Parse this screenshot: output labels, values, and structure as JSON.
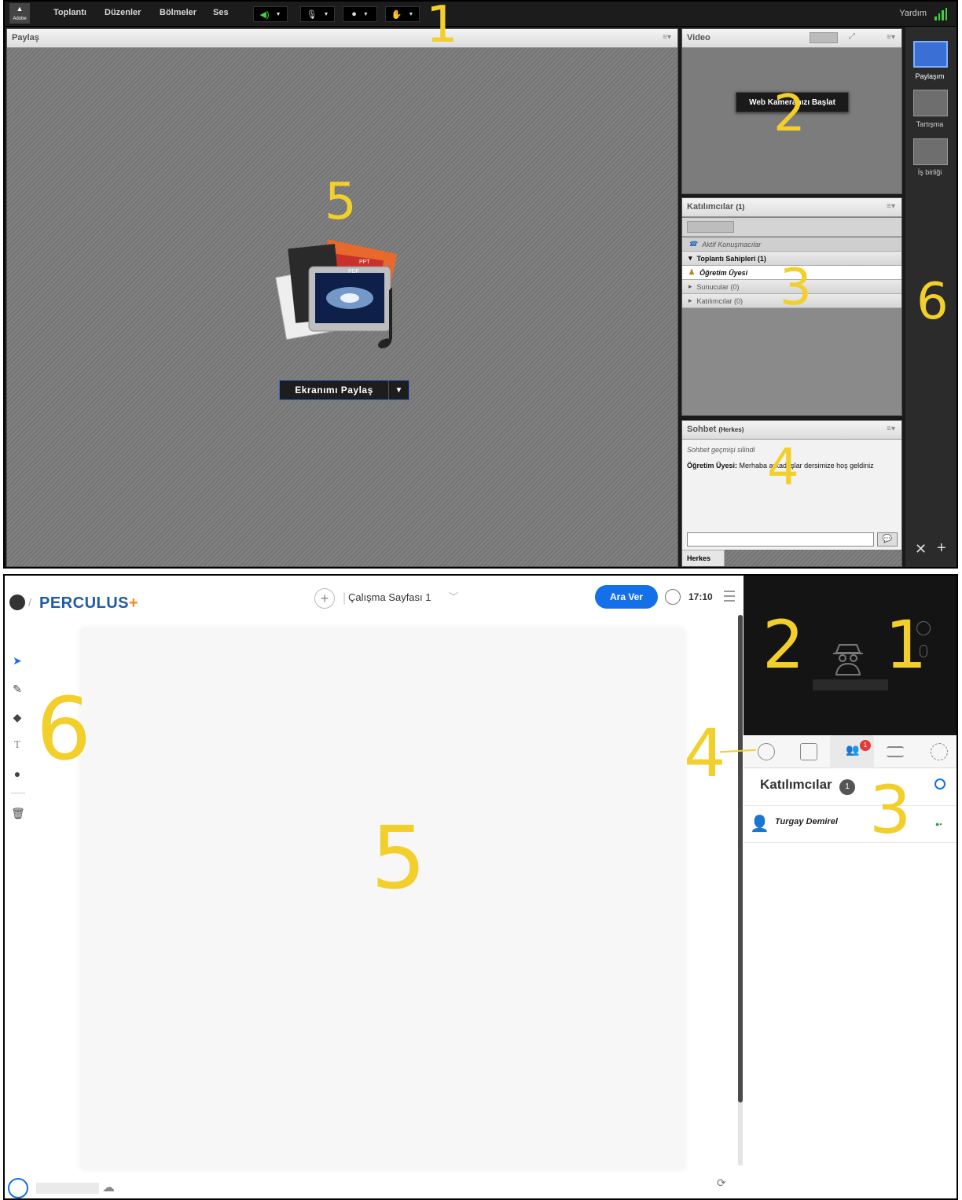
{
  "adobe": {
    "menu": [
      "Toplantı",
      "Düzenler",
      "Bölmeler",
      "Ses"
    ],
    "help": "Yardım",
    "share_pod": {
      "title": "Paylaş",
      "button": "Ekranımı Paylaş",
      "doc_labels": [
        "PPT",
        "PDF"
      ]
    },
    "video_pod": {
      "title": "Video",
      "button": "Web Kameranızı Başlat"
    },
    "attendees_pod": {
      "title": "Katılımcılar",
      "count": "(1)",
      "active_speakers": "Aktif Konuşmacılar",
      "groups": [
        "Toplantı Sahipleri (1)",
        "Sunucular (0)",
        "Katılımcılar (0)"
      ],
      "host": "Öğretim Üyesi"
    },
    "chat_pod": {
      "title": "Sohbet",
      "scope": "(Herkes)",
      "history_cleared": "Sohbet geçmişi silindi",
      "sender": "Öğretim Üyesi:",
      "message": " Merhaba arkadaşlar dersimize hoş geldiniz",
      "recipient_tab": "Herkes"
    },
    "layouts": [
      "Paylaşım",
      "Tartışma",
      "İş birliği"
    ]
  },
  "perculus": {
    "brand": "PERCULUS",
    "brand_plus": "+",
    "page_name": "Çalışma Sayfası 1",
    "break_button": "Ara Ver",
    "time": "17:10",
    "participants_title": "Katılımcılar",
    "participants_count": "1",
    "participant_name": "Turgay Demirel",
    "tab_badge": "1"
  },
  "callouts": {
    "adobe": [
      "1",
      "2",
      "3",
      "4",
      "5",
      "6"
    ],
    "perculus": [
      "1",
      "2",
      "3",
      "4",
      "5",
      "6"
    ]
  },
  "colors": {
    "accent_blue": "#1370e8",
    "brand_orange": "#f58a1f",
    "callout_yellow": "#f2cf2b",
    "ac_select": "#3a6fd6"
  },
  "icons": [
    "speaker-icon",
    "microphone-icon",
    "webcam-icon",
    "raise-hand-icon",
    "signal-icon",
    "menu-icon",
    "search-icon",
    "clock-icon",
    "chat-icon",
    "folder-icon",
    "participants-icon",
    "list-icon",
    "gear-icon",
    "pointer-icon",
    "pencil-icon",
    "eraser-icon",
    "text-icon",
    "color-icon",
    "delete-icon",
    "upload-icon",
    "share-icon"
  ]
}
